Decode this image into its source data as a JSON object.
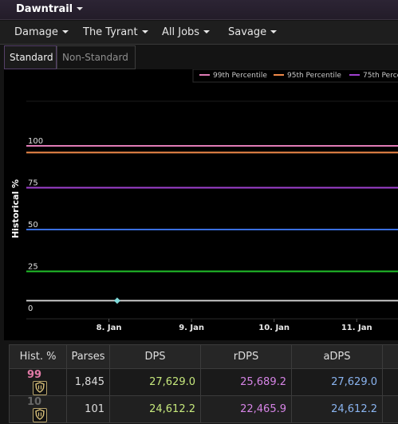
{
  "zone_title": "Dawntrail",
  "nav": {
    "metric": "Damage",
    "boss": "The Tyrant",
    "jobs": "All Jobs",
    "difficulty": "Savage"
  },
  "tabs": {
    "standard": "Standard",
    "non_standard": "Non-Standard"
  },
  "colors": {
    "p99": "#e07bb6",
    "p95": "#f08a4a",
    "p75": "#a040d0",
    "p50": "#3a6fe0",
    "p25": "#22c02a",
    "player": "#c8c8c8",
    "point": "#7fd9d9",
    "dps": "#c6e87c",
    "rdps": "#d684e6",
    "adps": "#8ab4f0",
    "rank99": "#e17aa6",
    "rank10": "#666666"
  },
  "chart_data": {
    "type": "line",
    "ylabel": "Historical %",
    "ylim": [
      0,
      100
    ],
    "y_ticks": [
      "0",
      "25",
      "50",
      "75",
      "100"
    ],
    "x_ticks": [
      "8. Jan",
      "9. Jan",
      "10. Jan",
      "11. Jan"
    ],
    "x_tick_values": [
      8,
      9,
      10,
      11
    ],
    "xlim": [
      7.0,
      11.5
    ],
    "legend": [
      "99th Percentile",
      "95th Percentile",
      "75th Percentile"
    ],
    "legend_placement": "top-right",
    "series": [
      {
        "name": "99th Percentile",
        "values": [
          100,
          100
        ]
      },
      {
        "name": "95th Percentile",
        "values": [
          96,
          96
        ]
      },
      {
        "name": "75th Percentile",
        "values": [
          75,
          75
        ]
      },
      {
        "name": "",
        "values": [
          50,
          50
        ]
      },
      {
        "name": "",
        "values": [
          25,
          25
        ]
      },
      {
        "name": "",
        "values": [
          7.5,
          7.5
        ]
      }
    ],
    "points": [
      {
        "x": 8.1,
        "y": 7.5
      }
    ]
  },
  "table": {
    "headers": [
      "Hist. %",
      "Parses",
      "DPS",
      "rDPS",
      "aDPS"
    ],
    "rows": [
      {
        "hist": "99",
        "parses": "1,845",
        "dps": "27,629.0",
        "rdps": "25,689.2",
        "adps": "27,629.0"
      },
      {
        "hist": "10",
        "parses": "101",
        "dps": "24,612.2",
        "rdps": "22,465.9",
        "adps": "24,612.2"
      }
    ]
  }
}
